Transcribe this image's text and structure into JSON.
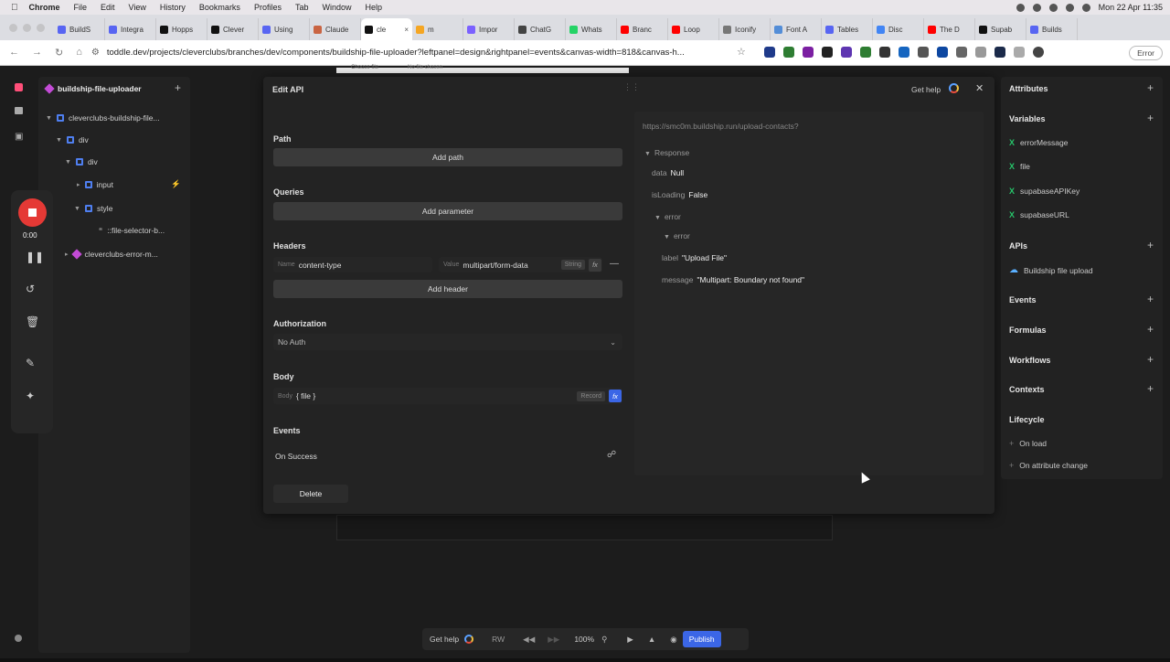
{
  "menubar": {
    "app": "Chrome",
    "items": [
      "File",
      "Edit",
      "View",
      "History",
      "Bookmarks",
      "Profiles",
      "Tab",
      "Window",
      "Help"
    ],
    "datetime": "Mon 22 Apr 11:35"
  },
  "tabs": [
    {
      "title": "BuildS",
      "color": "#5865f2"
    },
    {
      "title": "Integra",
      "color": "#5865f2"
    },
    {
      "title": "Hopps",
      "color": "#111111"
    },
    {
      "title": "Clever",
      "color": "#111111"
    },
    {
      "title": "Using",
      "color": "#5865f2"
    },
    {
      "title": "Claude",
      "color": "#c96442"
    },
    {
      "title": "cle",
      "color": "#111111",
      "active": true
    },
    {
      "title": "m",
      "color": "#f5a623"
    },
    {
      "title": "Impor",
      "color": "#7b61ff"
    },
    {
      "title": "ChatG",
      "color": "#444444"
    },
    {
      "title": "Whats",
      "color": "#25d366"
    },
    {
      "title": "Branc",
      "color": "#ff0000"
    },
    {
      "title": "Loop",
      "color": "#ff0000"
    },
    {
      "title": "Iconify",
      "color": "#777777"
    },
    {
      "title": "Font A",
      "color": "#538dd7"
    },
    {
      "title": "Tables",
      "color": "#5865f2"
    },
    {
      "title": "Disc",
      "color": "#4285f4"
    },
    {
      "title": "The D",
      "color": "#ff0000"
    },
    {
      "title": "Supab",
      "color": "#111111"
    },
    {
      "title": "Builds",
      "color": "#5865f2"
    }
  ],
  "address": {
    "url": "toddle.dev/projects/cleverclubs/branches/dev/components/buildship-file-uploader?leftpanel=design&rightpanel=events&canvas-width=818&canvas-h...",
    "error_label": "Error"
  },
  "leftpanel": {
    "component": "buildship-file-uploader",
    "tree": [
      {
        "label": "cleverclubs-buildship-file...",
        "kind": "elem"
      },
      {
        "label": "div",
        "kind": "elem"
      },
      {
        "label": "div",
        "kind": "elem"
      },
      {
        "label": "input",
        "kind": "elem"
      },
      {
        "label": "style",
        "kind": "elem"
      },
      {
        "label": "::file-selector-b...",
        "kind": "quote"
      },
      {
        "label": "cleverclubs-error-m...",
        "kind": "component"
      }
    ]
  },
  "recorder": {
    "time": "0:00"
  },
  "canvas": {
    "top_text_1": "Choose file",
    "top_text_2": "No file chosen"
  },
  "modal": {
    "title": "Edit API",
    "get_help": "Get help",
    "path_label": "Path",
    "add_path": "Add path",
    "queries_label": "Queries",
    "add_parameter": "Add parameter",
    "headers_label": "Headers",
    "header_name_prefix": "Name",
    "header_name": "content-type",
    "header_value_prefix": "Value",
    "header_value": "multipart/form-data",
    "header_type": "String",
    "add_header": "Add header",
    "auth_label": "Authorization",
    "auth_value": "No Auth",
    "body_label": "Body",
    "body_prefix": "Body",
    "body_value": "{ file }",
    "body_type": "Record",
    "events_label": "Events",
    "on_success": "On Success",
    "delete": "Delete",
    "fx": "fx"
  },
  "preview": {
    "url": "https://smc0m.buildship.run/upload-contacts?",
    "response": "Response",
    "data_key": "data",
    "data_val": "Null",
    "loading_key": "isLoading",
    "loading_val": "False",
    "error_key": "error",
    "error_inner": "error",
    "label_key": "label",
    "label_val": "\"Upload File\"",
    "message_key": "message",
    "message_val": "\"Multipart: Boundary not found\""
  },
  "rightpanel": {
    "attributes": "Attributes",
    "variables": "Variables",
    "variable_items": [
      "errorMessage",
      "file",
      "supabaseAPIKey",
      "supabaseURL"
    ],
    "apis": "APIs",
    "api_items": [
      "Buildship file upload"
    ],
    "events": "Events",
    "formulas": "Formulas",
    "workflows": "Workflows",
    "contexts": "Contexts",
    "lifecycle": "Lifecycle",
    "lifecycle_items": [
      "On load",
      "On attribute change"
    ]
  },
  "bottombar": {
    "get_help": "Get help",
    "rw": "RW",
    "zoom": "100%",
    "publish": "Publish"
  }
}
